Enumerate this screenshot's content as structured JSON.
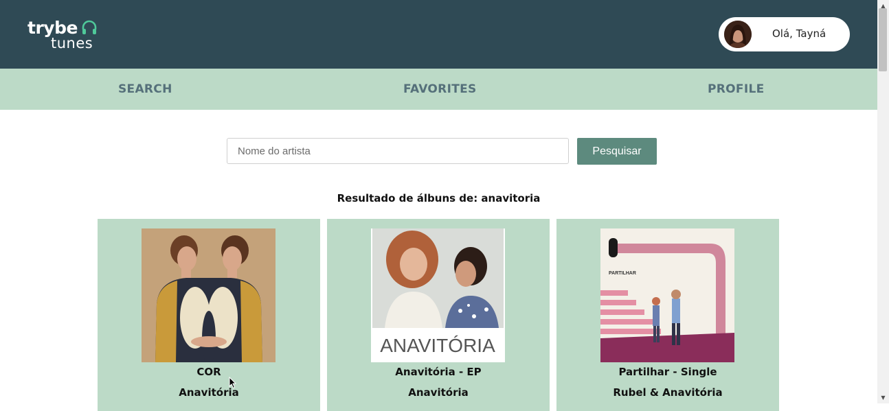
{
  "header": {
    "logo": {
      "line1": "trybe",
      "line2": "tunes"
    },
    "user": {
      "greeting": "Olá, Tayná"
    }
  },
  "nav": {
    "items": [
      {
        "label": "SEARCH"
      },
      {
        "label": "FAVORITES"
      },
      {
        "label": "PROFILE"
      }
    ]
  },
  "search": {
    "placeholder": "Nome do artista",
    "value": "",
    "button_label": "Pesquisar"
  },
  "results": {
    "title": "Resultado de álbuns de: anavitoria",
    "albums": [
      {
        "name": "COR",
        "artist": "Anavitória"
      },
      {
        "name": "Anavitória - EP",
        "artist": "Anavitória",
        "cover_text": "ANAVITÓRIA"
      },
      {
        "name": "Partilhar - Single",
        "artist": "Rubel & Anavitória",
        "cover_text": "PARTILHAR"
      }
    ]
  },
  "colors": {
    "header_bg": "#2f4a55",
    "nav_bg": "#bcdac7",
    "nav_text": "#55707a",
    "card_bg": "#bcdac7",
    "button_bg": "#5d8a7e"
  },
  "icons": {
    "logo": "headphones-icon",
    "scroll_up": "triangle-up-icon",
    "scroll_down": "triangle-down-icon",
    "cursor": "mouse-pointer-icon"
  }
}
